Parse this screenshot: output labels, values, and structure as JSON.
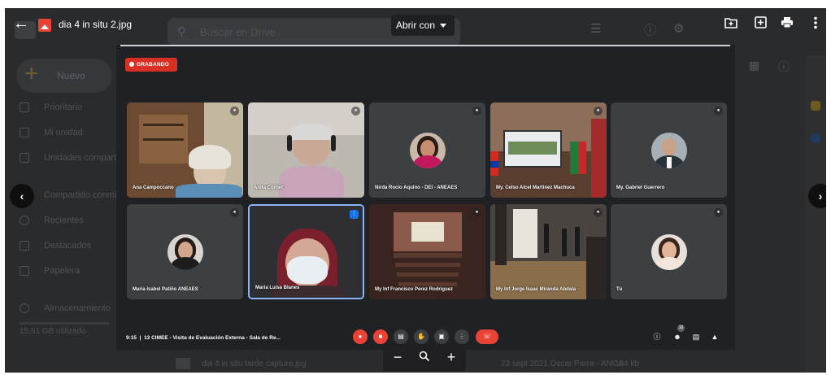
{
  "window": {
    "file_title": "dia 4 in situ 2.jpg",
    "open_with_label": "Abrir con",
    "toolbar_icons": [
      "add-to-drive-icon",
      "add-shortcut-icon",
      "print-icon",
      "more-vert-icon"
    ]
  },
  "drive_background": {
    "search_placeholder": "Buscar en Drive",
    "new_label": "Nuevo",
    "nav": [
      "Prioritario",
      "Mi unidad",
      "Unidades compartidas",
      "Compartido conmigo",
      "Recientes",
      "Destacados",
      "Papelera",
      "Almacenamiento"
    ],
    "storage_text": "15,81 GB utilizado",
    "file_name": "dia 4 in situ tarde captura.jpg",
    "file_modified": "23 sept 2021 Oscar Parra - ANCA",
    "file_size": "104 kb"
  },
  "meeting": {
    "recording_label": "GRABANDO",
    "participants": [
      {
        "name": "Ana Campoccano",
        "kind": "video-room"
      },
      {
        "name": "Anita Cornet",
        "kind": "video-headset"
      },
      {
        "name": "Nirda Rocio Aquino - DEI - ANEAES",
        "kind": "avatar"
      },
      {
        "name": "My. Celso Alcel Martinez Machuca",
        "kind": "video-screen"
      },
      {
        "name": "My. Gabriel Guerrero",
        "kind": "avatar"
      },
      {
        "name": "Maria Isabel Patiño ANEAES",
        "kind": "avatar"
      },
      {
        "name": "Maria Luisa Blanes",
        "kind": "video-mask"
      },
      {
        "name": "My Inf Francisco Perez Rodriguez",
        "kind": "video-auditorium"
      },
      {
        "name": "My Inf Jorge Isaac Miranda Abdala",
        "kind": "video-hall"
      },
      {
        "name": "Tú",
        "kind": "avatar"
      }
    ],
    "time": "9:15",
    "meeting_title": "13 CIMEE - Visita de Evaluación Externa - Sala de Re...",
    "people_count": "10",
    "controls": [
      "mic-off-icon",
      "camera-off-icon",
      "captions-icon",
      "raise-hand-icon",
      "present-icon",
      "more-options-icon",
      "hang-up-icon"
    ],
    "right_controls": [
      "info-icon",
      "people-icon",
      "chat-icon",
      "activities-icon"
    ]
  },
  "zoom": {
    "minus": "−",
    "plus": "+"
  }
}
